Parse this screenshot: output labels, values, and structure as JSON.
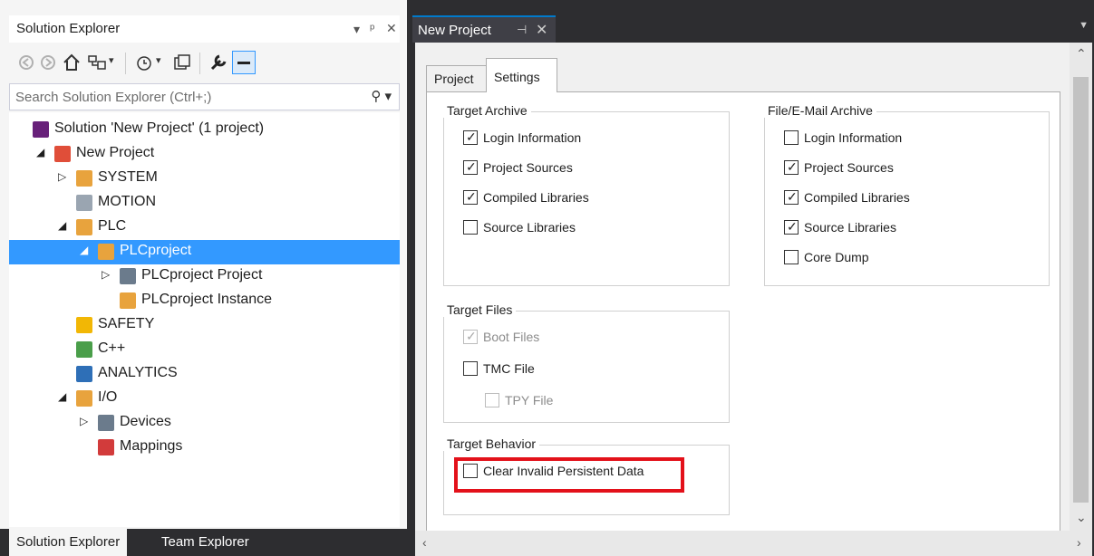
{
  "solution_explorer": {
    "title": "Solution Explorer",
    "title_buttons": {
      "dropdown": "▾",
      "pin": "ᵖ",
      "close": "✕"
    },
    "search_placeholder": "Search Solution Explorer (Ctrl+;)",
    "tree": [
      {
        "label": "Solution 'New Project' (1 project)",
        "icon": "solution-icon",
        "indent": 0,
        "expander": ""
      },
      {
        "label": "New Project",
        "icon": "project-icon",
        "indent": 1,
        "expander": "◢"
      },
      {
        "label": "SYSTEM",
        "icon": "system-icon",
        "indent": 2,
        "expander": "▷"
      },
      {
        "label": "MOTION",
        "icon": "motion-icon",
        "indent": 2,
        "expander": ""
      },
      {
        "label": "PLC",
        "icon": "plc-icon",
        "indent": 2,
        "expander": "◢"
      },
      {
        "label": "PLCproject",
        "icon": "plc-icon",
        "indent": 3,
        "expander": "◢",
        "selected": true
      },
      {
        "label": "PLCproject Project",
        "icon": "plc-project-icon",
        "indent": 4,
        "expander": "▷"
      },
      {
        "label": "PLCproject Instance",
        "icon": "plc-instance-icon",
        "indent": 4,
        "expander": ""
      },
      {
        "label": "SAFETY",
        "icon": "safety-icon",
        "indent": 2,
        "expander": ""
      },
      {
        "label": "C++",
        "icon": "cpp-icon",
        "indent": 2,
        "expander": ""
      },
      {
        "label": "ANALYTICS",
        "icon": "analytics-icon",
        "indent": 2,
        "expander": ""
      },
      {
        "label": "I/O",
        "icon": "io-icon",
        "indent": 2,
        "expander": "◢"
      },
      {
        "label": "Devices",
        "icon": "devices-icon",
        "indent": 3,
        "expander": "▷"
      },
      {
        "label": "Mappings",
        "icon": "mappings-icon",
        "indent": 3,
        "expander": ""
      }
    ],
    "bottom_tabs": [
      "Solution Explorer",
      "Team Explorer"
    ]
  },
  "document": {
    "tab_title": "New Project",
    "tabs": [
      "Project",
      "Settings"
    ],
    "groups": {
      "target_archive": {
        "title": "Target Archive",
        "items": [
          {
            "label": "Login Information",
            "checked": true,
            "enabled": true
          },
          {
            "label": "Project Sources",
            "checked": true,
            "enabled": true
          },
          {
            "label": "Compiled Libraries",
            "checked": true,
            "enabled": true
          },
          {
            "label": "Source Libraries",
            "checked": false,
            "enabled": true
          }
        ]
      },
      "file_email_archive": {
        "title": "File/E-Mail Archive",
        "items": [
          {
            "label": "Login Information",
            "checked": false,
            "enabled": true
          },
          {
            "label": "Project Sources",
            "checked": true,
            "enabled": true
          },
          {
            "label": "Compiled Libraries",
            "checked": true,
            "enabled": true
          },
          {
            "label": "Source Libraries",
            "checked": true,
            "enabled": true
          },
          {
            "label": "Core Dump",
            "checked": false,
            "enabled": true
          }
        ]
      },
      "target_files": {
        "title": "Target Files",
        "items": [
          {
            "label": "Boot Files",
            "checked": true,
            "enabled": false
          },
          {
            "label": "TMC File",
            "checked": false,
            "enabled": true
          },
          {
            "label": "TPY File",
            "checked": false,
            "enabled": false
          }
        ]
      },
      "target_behavior": {
        "title": "Target Behavior",
        "items": [
          {
            "label": "Clear Invalid Persistent Data",
            "checked": false,
            "enabled": true
          }
        ]
      }
    }
  },
  "colors": {
    "selection": "#3399ff",
    "highlight": "#e3111a",
    "accent": "#007acc"
  }
}
